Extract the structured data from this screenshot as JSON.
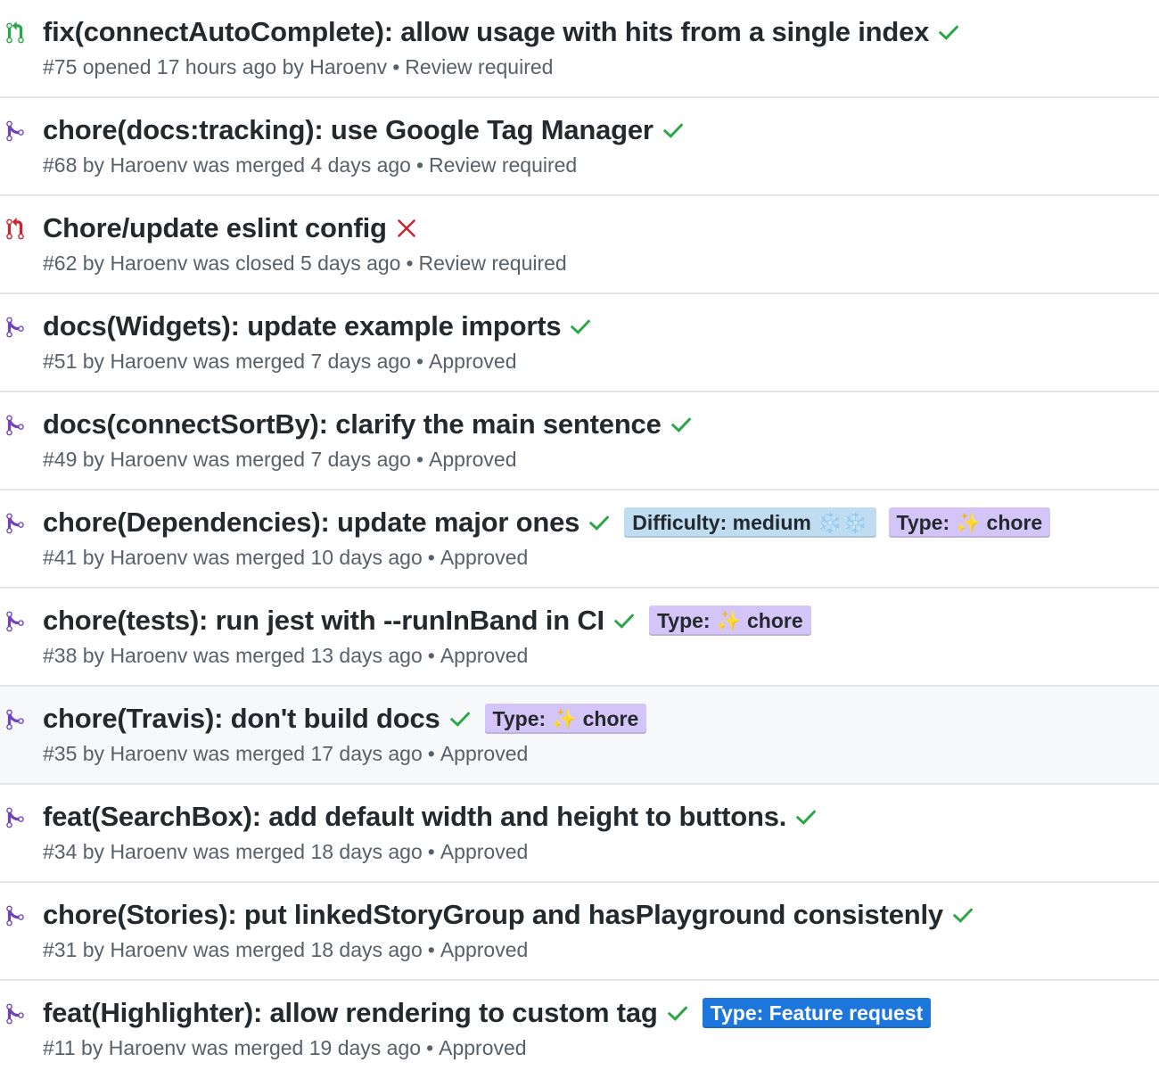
{
  "colors": {
    "open": "#28a745",
    "merged": "#6f42c1",
    "closed": "#cb2431",
    "check": "#28a745",
    "cross": "#cb2431"
  },
  "pull_requests": [
    {
      "state": "open",
      "state_icon": "git-pull-request-open-icon",
      "title": "fix(connectAutoComplete): allow usage with hits from a single index",
      "status": "success",
      "meta": "#75 opened 17 hours ago by Haroenv",
      "review": "Review required",
      "labels": []
    },
    {
      "state": "merged",
      "state_icon": "git-merge-icon",
      "title": "chore(docs:tracking): use Google Tag Manager",
      "status": "success",
      "meta": "#68 by Haroenv was merged 4 days ago",
      "review": "Review required",
      "labels": []
    },
    {
      "state": "closed",
      "state_icon": "git-pull-request-closed-icon",
      "title": "Chore/update eslint config",
      "status": "failure",
      "meta": "#62 by Haroenv was closed 5 days ago",
      "review": "Review required",
      "labels": []
    },
    {
      "state": "merged",
      "state_icon": "git-merge-icon",
      "title": "docs(Widgets): update example imports",
      "status": "success",
      "meta": "#51 by Haroenv was merged 7 days ago",
      "review": "Approved",
      "labels": []
    },
    {
      "state": "merged",
      "state_icon": "git-merge-icon",
      "title": "docs(connectSortBy): clarify the main sentence",
      "status": "success",
      "meta": "#49 by Haroenv was merged 7 days ago",
      "review": "Approved",
      "labels": []
    },
    {
      "state": "merged",
      "state_icon": "git-merge-icon",
      "title": "chore(Dependencies): update major ones",
      "status": "success",
      "meta": "#41 by Haroenv was merged 10 days ago",
      "review": "Approved",
      "labels": [
        {
          "text": "Difficulty: medium ❄️❄️",
          "bg": "#bfdcf0",
          "color": "#24292e"
        },
        {
          "text": "Type: ✨ chore",
          "bg": "#d4c5f9",
          "color": "#24292e"
        }
      ]
    },
    {
      "state": "merged",
      "state_icon": "git-merge-icon",
      "title": "chore(tests): run jest with --runInBand in CI",
      "status": "success",
      "meta": "#38 by Haroenv was merged 13 days ago",
      "review": "Approved",
      "labels": [
        {
          "text": "Type: ✨ chore",
          "bg": "#d4c5f9",
          "color": "#24292e"
        }
      ]
    },
    {
      "state": "merged",
      "state_icon": "git-merge-icon",
      "title": "chore(Travis): don't build docs",
      "status": "success",
      "meta": "#35 by Haroenv was merged 17 days ago",
      "review": "Approved",
      "highlighted": true,
      "labels": [
        {
          "text": "Type: ✨ chore",
          "bg": "#d4c5f9",
          "color": "#24292e"
        }
      ]
    },
    {
      "state": "merged",
      "state_icon": "git-merge-icon",
      "title": "feat(SearchBox): add default width and height to buttons.",
      "status": "success",
      "meta": "#34 by Haroenv was merged 18 days ago",
      "review": "Approved",
      "labels": []
    },
    {
      "state": "merged",
      "state_icon": "git-merge-icon",
      "title": "chore(Stories): put linkedStoryGroup and hasPlayground consistenly",
      "status": "success",
      "meta": "#31 by Haroenv was merged 18 days ago",
      "review": "Approved",
      "labels": []
    },
    {
      "state": "merged",
      "state_icon": "git-merge-icon",
      "title": "feat(Highlighter): allow rendering to custom tag",
      "status": "success",
      "meta": "#11 by Haroenv was merged 19 days ago",
      "review": "Approved",
      "labels": [
        {
          "text": "Type: Feature request",
          "bg": "#1d76db",
          "color": "#ffffff"
        }
      ]
    }
  ]
}
